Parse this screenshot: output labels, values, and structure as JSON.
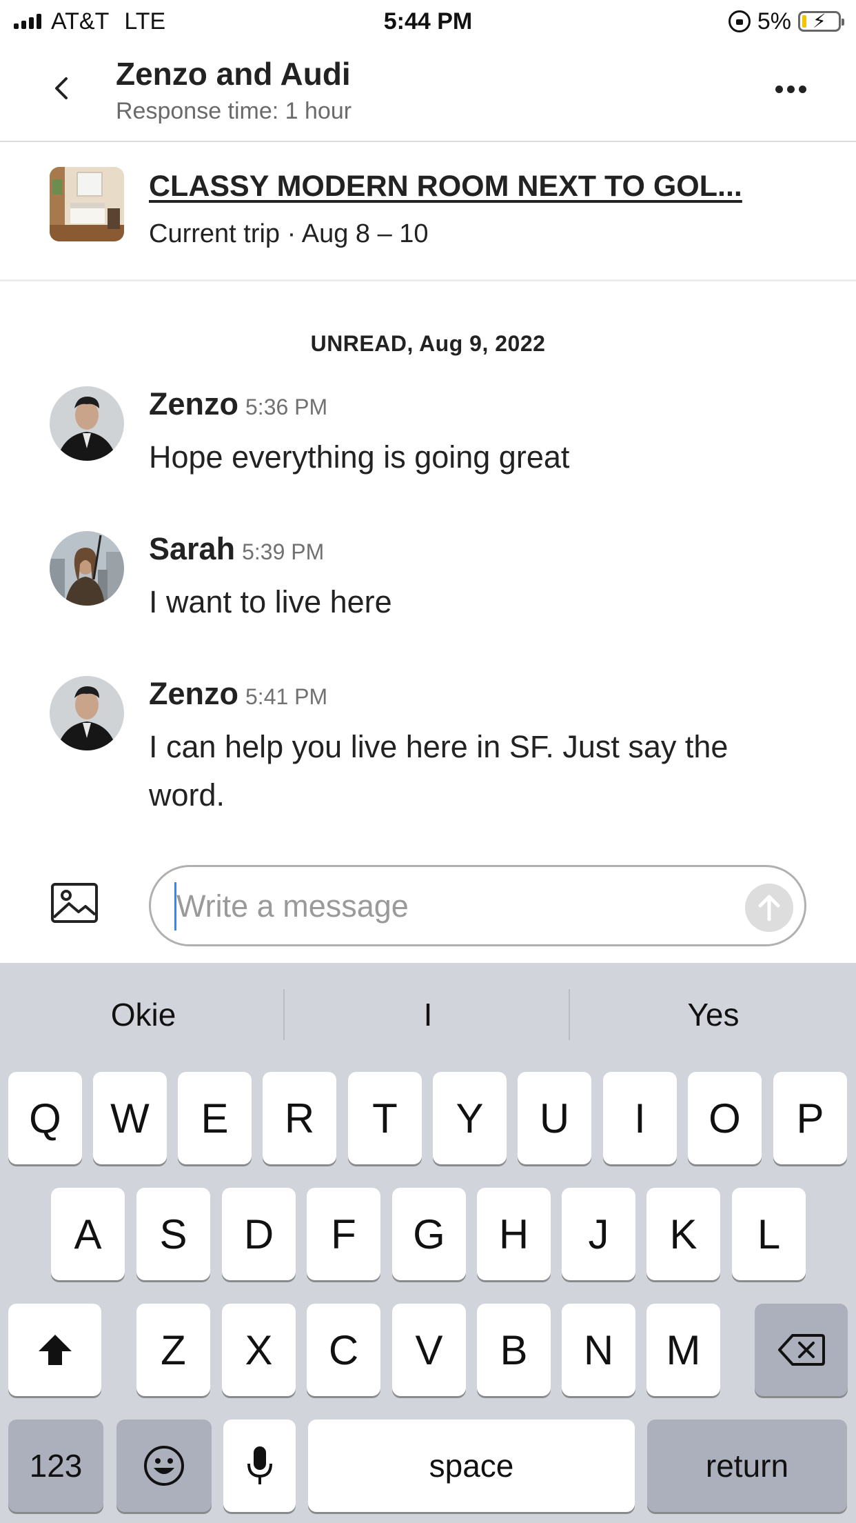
{
  "status_bar": {
    "carrier": "AT&T",
    "network": "LTE",
    "time": "5:44 PM",
    "battery": "5%",
    "icons": [
      "signal-icon",
      "orientation-lock-icon",
      "battery-charging-icon"
    ]
  },
  "header": {
    "title": "Zenzo and Audi",
    "subtitle": "Response time: 1 hour",
    "icons": [
      "back-chevron-icon",
      "more-icon"
    ]
  },
  "listing": {
    "title": "CLASSY MODERN ROOM NEXT TO GOL...",
    "subtitle": "Current trip · Aug 8 – 10"
  },
  "conversation": {
    "date_separator": "UNREAD, Aug 9, 2022",
    "messages": [
      {
        "sender": "Zenzo",
        "time": "5:36 PM",
        "text": "Hope everything is going great"
      },
      {
        "sender": "Sarah",
        "time": "5:39 PM",
        "text": "I want to live here"
      },
      {
        "sender": "Zenzo",
        "time": "5:41 PM",
        "text": "I can help you live here in SF. Just say the word."
      }
    ]
  },
  "composer": {
    "placeholder": "Write a message",
    "value": "",
    "icons": [
      "image-icon",
      "send-arrow-icon"
    ]
  },
  "keyboard": {
    "suggestions": [
      "Okie",
      "I",
      "Yes"
    ],
    "row1": [
      "Q",
      "W",
      "E",
      "R",
      "T",
      "Y",
      "U",
      "I",
      "O",
      "P"
    ],
    "row2": [
      "A",
      "S",
      "D",
      "F",
      "G",
      "H",
      "J",
      "K",
      "L"
    ],
    "row3": [
      "Z",
      "X",
      "C",
      "V",
      "B",
      "N",
      "M"
    ],
    "numbers_label": "123",
    "space_label": "space",
    "return_label": "return",
    "icons": [
      "shift-icon",
      "delete-icon",
      "emoji-icon",
      "microphone-icon"
    ]
  },
  "colors": {
    "text_primary": "#222222",
    "text_secondary": "#717171",
    "keyboard_bg": "#d1d4db",
    "key_bg": "#ffffff",
    "key_dark_bg": "#abb0bc",
    "cursor": "#3b82f6"
  }
}
